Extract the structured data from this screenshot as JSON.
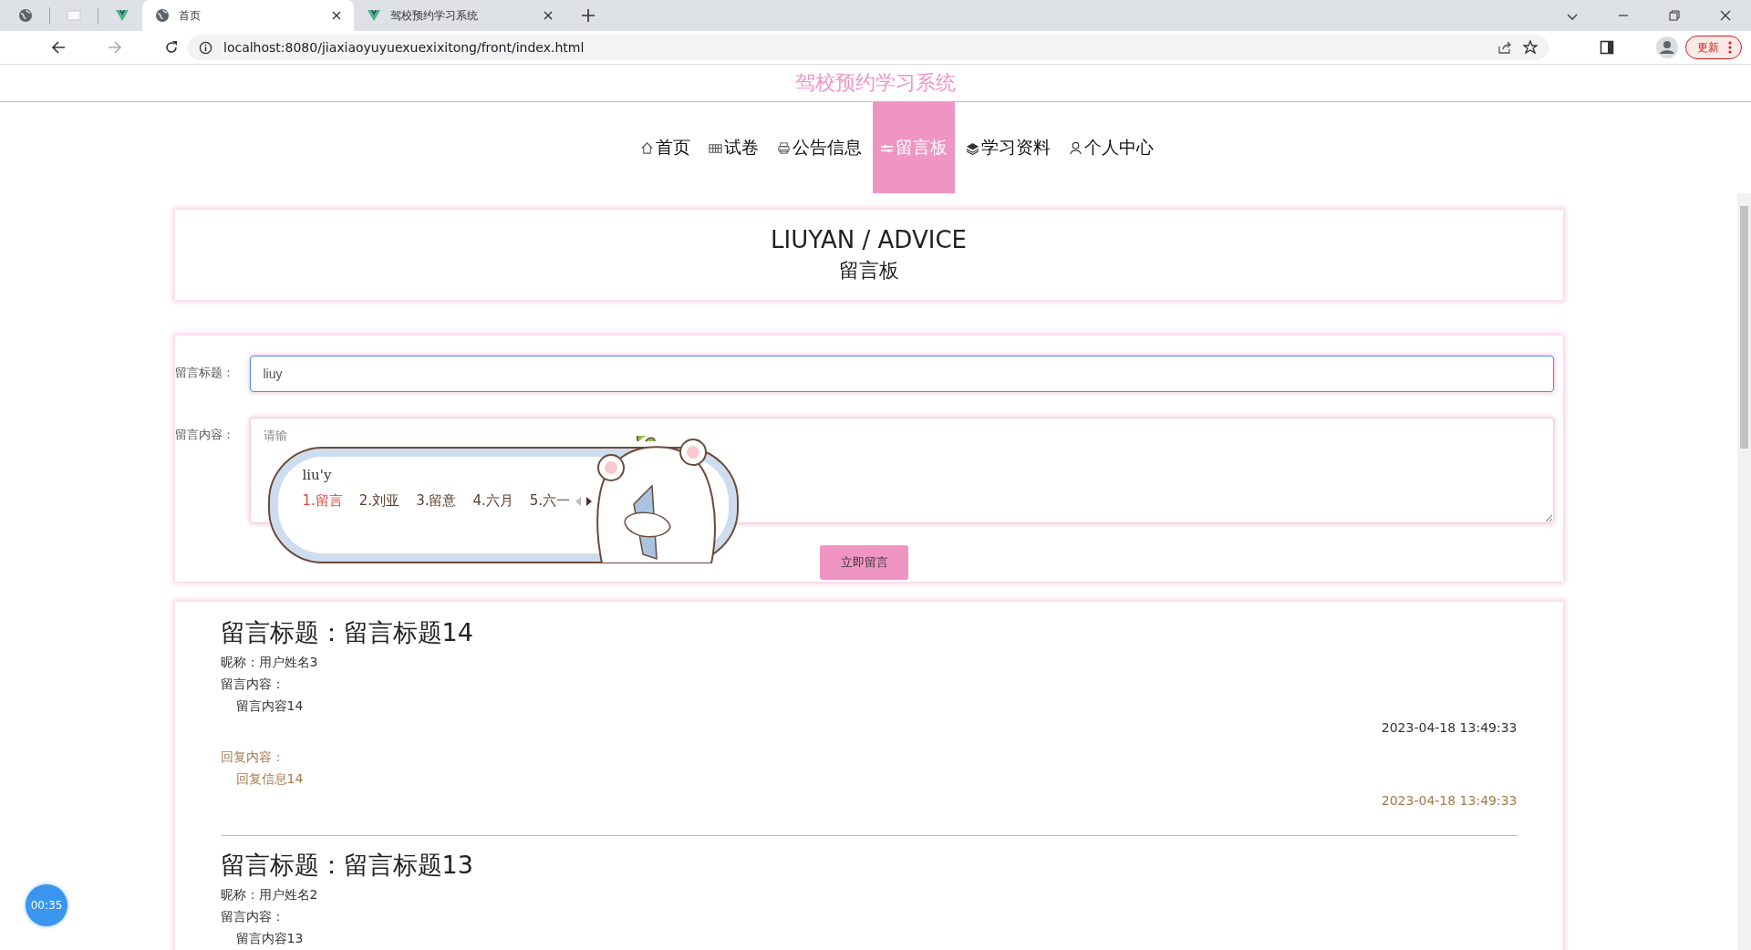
{
  "browser": {
    "tabs": [
      {
        "title": "首页",
        "selected": true
      },
      {
        "title": "驾校预约学习系统",
        "selected": false
      }
    ],
    "address": "localhost:8080/jiaxiaoyuyuexuexixitong/front/index.html",
    "update_button": "更新"
  },
  "site_title": "驾校预约学习系统",
  "nav": [
    {
      "label": "首页",
      "selected": false
    },
    {
      "label": "试卷",
      "selected": false
    },
    {
      "label": "公告信息",
      "selected": false
    },
    {
      "label": "留言板",
      "selected": true
    },
    {
      "label": "学习资料",
      "selected": false
    },
    {
      "label": "个人中心",
      "selected": false
    }
  ],
  "header": {
    "title": "LIUYAN / ADVICE",
    "subtitle": "留言板"
  },
  "form": {
    "fields": [
      {
        "kind": "input",
        "label": "留言标题：",
        "value": "liuy"
      },
      {
        "kind": "textarea",
        "label": "留言内容：",
        "placeholder": "请输"
      }
    ],
    "submit": "立即留言"
  },
  "ime": {
    "composition": "liu'y",
    "candidates": [
      {
        "label": "1.留言",
        "selected": true
      },
      {
        "label": "2.刘亚",
        "selected": false
      },
      {
        "label": "3.留意",
        "selected": false
      },
      {
        "label": "4.六月",
        "selected": false
      },
      {
        "label": "5.六一",
        "selected": false
      }
    ]
  },
  "messages": [
    {
      "title": "留言标题：留言标题14",
      "nickname": "昵称：用户姓名3",
      "content_label": "留言内容：",
      "content": "留言内容14",
      "date": "2023-04-18 13:49:33",
      "reply_label": "回复内容：",
      "reply": "回复信息14",
      "reply_date": "2023-04-18 13:49:33"
    },
    {
      "title": "留言标题：留言标题13",
      "nickname": "昵称：用户姓名2",
      "content_label": "留言内容：",
      "content": "留言内容13"
    }
  ],
  "timer": "00:35"
}
